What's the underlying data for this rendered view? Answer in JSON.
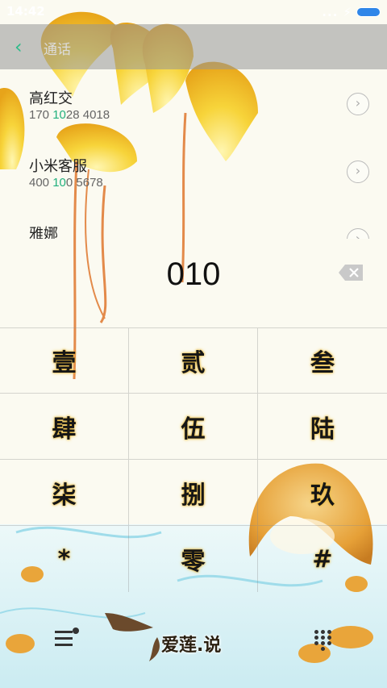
{
  "status_bar": {
    "time": "14:42",
    "signal": "...",
    "charging_icon": "bolt-icon"
  },
  "header": {
    "title": "通话",
    "back_icon": "chevron-left-icon"
  },
  "contacts": [
    {
      "name": "高红交",
      "number_pre": "170 ",
      "number_match": "10",
      "number_post": "28 4018"
    },
    {
      "name": "小米客服",
      "number_pre": "400 ",
      "number_match": "10",
      "number_post": "0 5678"
    },
    {
      "name": "雅娜",
      "number_pre": "",
      "number_match": "",
      "number_post": ""
    }
  ],
  "dial": {
    "digits": "010"
  },
  "keys": [
    "壹",
    "贰",
    "叁",
    "肆",
    "伍",
    "陆",
    "柒",
    "捌",
    "玖",
    "*",
    "零",
    "#"
  ],
  "bottom": {
    "brand": "爱莲.说"
  },
  "colors": {
    "accent": "#22b07d",
    "header_bg": "#969696"
  }
}
